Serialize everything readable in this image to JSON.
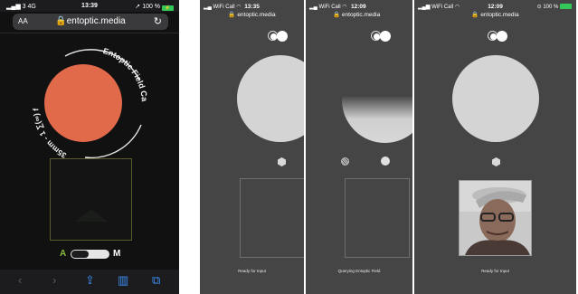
{
  "screens": [
    {
      "status": {
        "carrier": "3  4G",
        "time": "13:39",
        "battery": "100 %"
      },
      "browser": {
        "text_size": "AA",
        "url": "entoptic.media",
        "reload_icon": "reload-icon"
      },
      "ring_text": "Entoptic Field Camera",
      "ring_formula": "35mm - 1 ∑(∞) f",
      "mode": {
        "left": "A",
        "right": "M",
        "selected": "A"
      },
      "toolbar_icons": [
        "back-icon",
        "forward-icon",
        "share-icon",
        "bookmarks-icon",
        "tabs-icon"
      ],
      "colors": {
        "accent": "#e06a4a",
        "mode_a": "#8ab83a"
      }
    },
    {
      "status": {
        "carrier": "WiFi Call",
        "time": "13:35",
        "battery": ""
      },
      "url": "entoptic.media",
      "caption": "Ready for Input"
    },
    {
      "status": {
        "carrier": "WiFi Call",
        "time": "12:09",
        "battery": ""
      },
      "url": "entoptic.media",
      "caption": "Querying Entoptic Field"
    },
    {
      "status": {
        "carrier": "WiFi Call",
        "time": "12:09",
        "battery": "100 %"
      },
      "url": "entoptic.media",
      "caption": "Ready for Input"
    }
  ]
}
